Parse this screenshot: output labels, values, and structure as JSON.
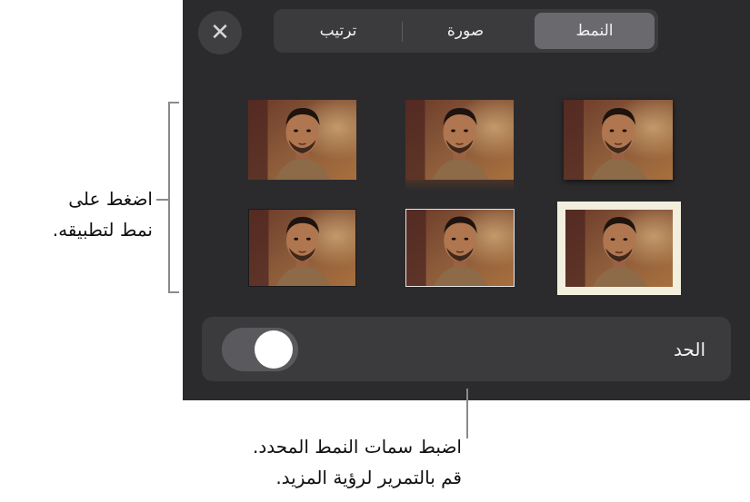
{
  "close_icon": "close-icon",
  "tabs": [
    {
      "label": "النمط",
      "active": true
    },
    {
      "label": "صورة",
      "active": false
    },
    {
      "label": "ترتيب",
      "active": false
    }
  ],
  "styles_grid": {
    "rows": 2,
    "columns": 3,
    "thumbnails": [
      {
        "style": "plain"
      },
      {
        "style": "reflection"
      },
      {
        "style": "plain-shadow"
      },
      {
        "style": "white-border-frame"
      },
      {
        "style": "thin-white-border"
      },
      {
        "style": "plain-dark-edge"
      }
    ]
  },
  "border_toggle": {
    "label": "الحد",
    "on": false
  },
  "callouts": {
    "grid_line1": "اضغط على",
    "grid_line2": "نمط لتطبيقه.",
    "bottom_line1": "اضبط سمات النمط المحدد.",
    "bottom_line2": "قم بالتمرير لرؤية المزيد."
  },
  "colors": {
    "panel": "#2b2b2d",
    "segment_bg": "#3b3b3e",
    "segment_active": "#6a6a6e",
    "frame_cream": "#f3efdf"
  }
}
